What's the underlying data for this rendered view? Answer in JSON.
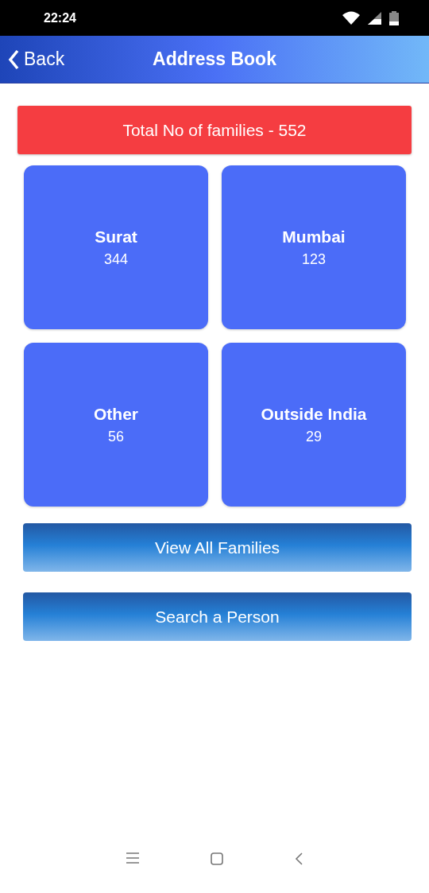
{
  "status_bar": {
    "time": "22:24"
  },
  "header": {
    "back": "Back",
    "title": "Address Book"
  },
  "total": "Total No of families - 552",
  "tiles": [
    {
      "name": "Surat",
      "count": "344"
    },
    {
      "name": "Mumbai",
      "count": "123"
    },
    {
      "name": "Other",
      "count": "56"
    },
    {
      "name": "Outside India",
      "count": "29"
    }
  ],
  "buttons": [
    "View All Families",
    "Search a Person"
  ]
}
